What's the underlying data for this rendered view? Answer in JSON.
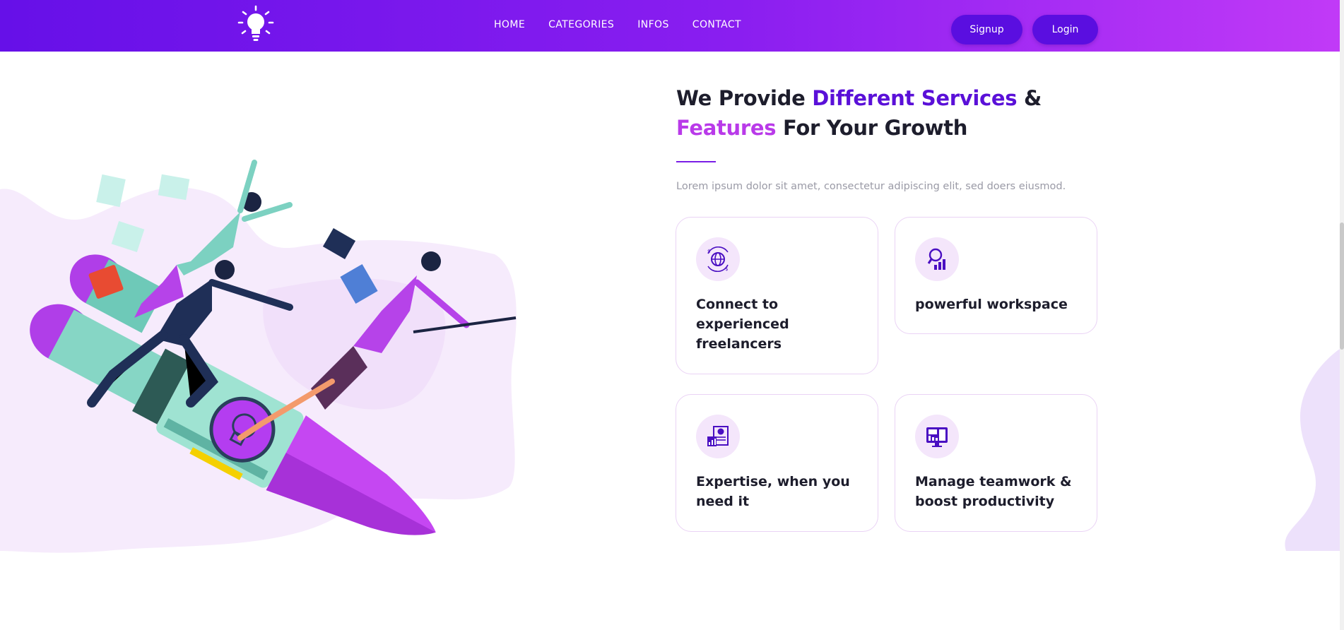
{
  "nav": {
    "logo_icon": "lightbulb-icon",
    "links": [
      "HOME",
      "CATEGORIES",
      "INFOS",
      "CONTACT"
    ],
    "signup": "Signup",
    "login": "Login"
  },
  "section": {
    "title_part1": "We Provide ",
    "title_highlight1": "Different Services",
    "title_part2": " &",
    "title_highlight2": "Features",
    "title_part3": " For Your Growth",
    "subtitle": "Lorem ipsum dolor sit amet, consectetur adipiscing elit, sed doers eiusmod."
  },
  "features": [
    {
      "title": "Connect to experienced freelancers",
      "icon": "globe-dollar-icon"
    },
    {
      "title": "powerful workspace",
      "icon": "search-analytics-icon"
    },
    {
      "title": "Expertise, when you need it",
      "icon": "report-chart-icon"
    },
    {
      "title": "Manage teamwork & boost productivity",
      "icon": "dashboard-monitor-icon"
    }
  ],
  "colors": {
    "nav_gradient_start": "#6610e8",
    "nav_gradient_end": "#c13af7",
    "accent_purple": "#5a10d8",
    "accent_violet": "#b93ae9",
    "card_border": "#ead3f5"
  }
}
